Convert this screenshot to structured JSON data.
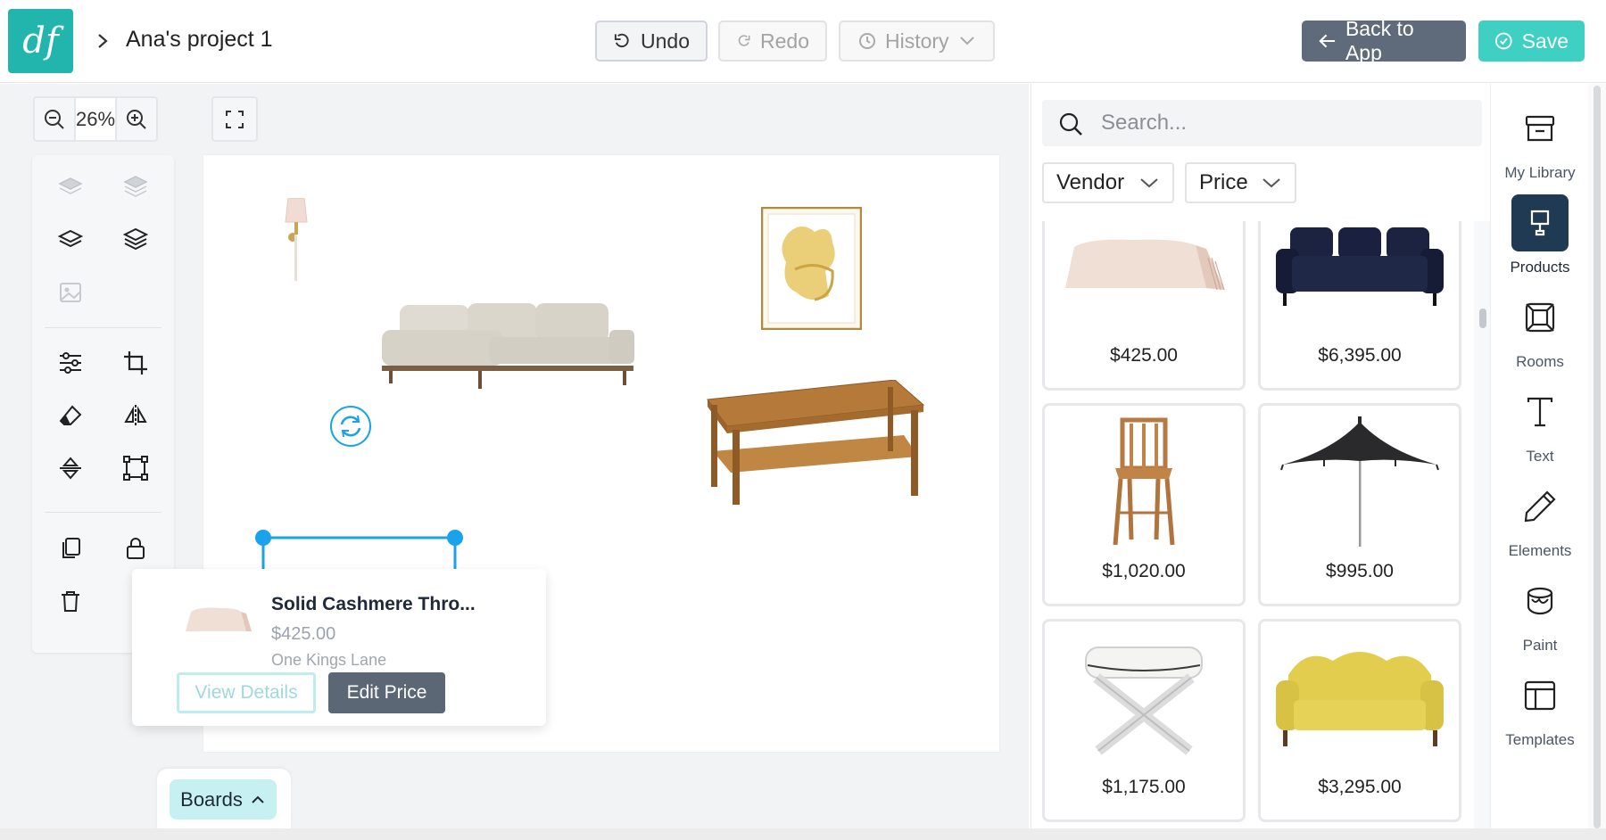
{
  "logo": {
    "text": "df"
  },
  "header": {
    "project_title": "Ana's project 1",
    "undo_label": "Undo",
    "redo_label": "Redo",
    "history_label": "History",
    "back_label": "Back to App",
    "save_label": "Save"
  },
  "canvas": {
    "zoom": "26%",
    "selected_item": {
      "name": "Solid Cashmere Thro...",
      "price": "$425.00",
      "vendor": "One Kings Lane",
      "view_details_label": "View Details",
      "edit_price_label": "Edit Price"
    },
    "boards_label": "Boards"
  },
  "panel": {
    "search_placeholder": "Search...",
    "filters": [
      {
        "label": "Vendor"
      },
      {
        "label": "Price"
      }
    ],
    "products": [
      {
        "price": "$425.00",
        "icon": "throw-blanket-icon"
      },
      {
        "price": "$6,395.00",
        "icon": "navy-sofa-icon"
      },
      {
        "price": "$1,020.00",
        "icon": "wooden-chair-icon"
      },
      {
        "price": "$995.00",
        "icon": "umbrella-icon"
      },
      {
        "price": "$1,175.00",
        "icon": "x-bench-icon"
      },
      {
        "price": "$3,295.00",
        "icon": "yellow-sofa-icon"
      }
    ]
  },
  "rail": {
    "items": [
      {
        "label": "My Library",
        "icon": "archive-icon",
        "active": false
      },
      {
        "label": "Products",
        "icon": "lamp-icon",
        "active": true
      },
      {
        "label": "Rooms",
        "icon": "room-icon",
        "active": false
      },
      {
        "label": "Text",
        "icon": "text-icon",
        "active": false
      },
      {
        "label": "Elements",
        "icon": "pen-icon",
        "active": false
      },
      {
        "label": "Paint",
        "icon": "paint-bucket-icon",
        "active": false
      },
      {
        "label": "Templates",
        "icon": "templates-icon",
        "active": false
      }
    ]
  },
  "colors": {
    "brand": "#22b5ad",
    "back_button": "#5f6b7a",
    "save_button": "#3dd0c3",
    "selection": "#1aa3ea",
    "active_rail": "#1f3a52"
  }
}
